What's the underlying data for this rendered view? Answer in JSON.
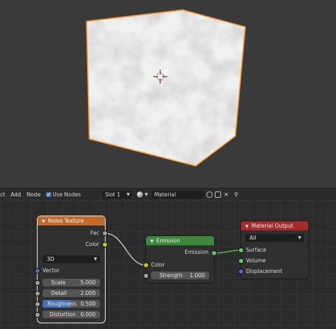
{
  "header": {
    "menu_fragment": "ct",
    "add": "Add",
    "node": "Node",
    "use_nodes": "Use Nodes",
    "slot": "Slot 1",
    "material": "Material"
  },
  "noise_texture": {
    "title": "Noise Texture",
    "out_fac": "Fac",
    "out_color": "Color",
    "dimensions": "3D",
    "in_vector": "Vector",
    "scale_label": "Scale",
    "scale_value": "5.000",
    "detail_label": "Detail",
    "detail_value": "2.000",
    "roughness_label": "Roughness",
    "roughness_value": "0.500",
    "distortion_label": "Distortion",
    "distortion_value": "0.000"
  },
  "emission": {
    "title": "Emission",
    "out_emission": "Emission",
    "in_color": "Color",
    "strength_label": "Strength",
    "strength_value": "1.000"
  },
  "material_output": {
    "title": "Material Output",
    "target": "All",
    "in_surface": "Surface",
    "in_volume": "Volume",
    "in_displacement": "Displacement"
  },
  "colors": {
    "texture_header": "#c06b2c",
    "shader_header": "#3b8a3b",
    "output_header": "#a32b2b",
    "selection_outline": "#f39530"
  },
  "icons": [
    "cursor-icon",
    "material-sphere-icon",
    "fake-user-icon",
    "new-material-icon",
    "unlink-icon",
    "pin-icon",
    "collapse-triangle-icon"
  ]
}
